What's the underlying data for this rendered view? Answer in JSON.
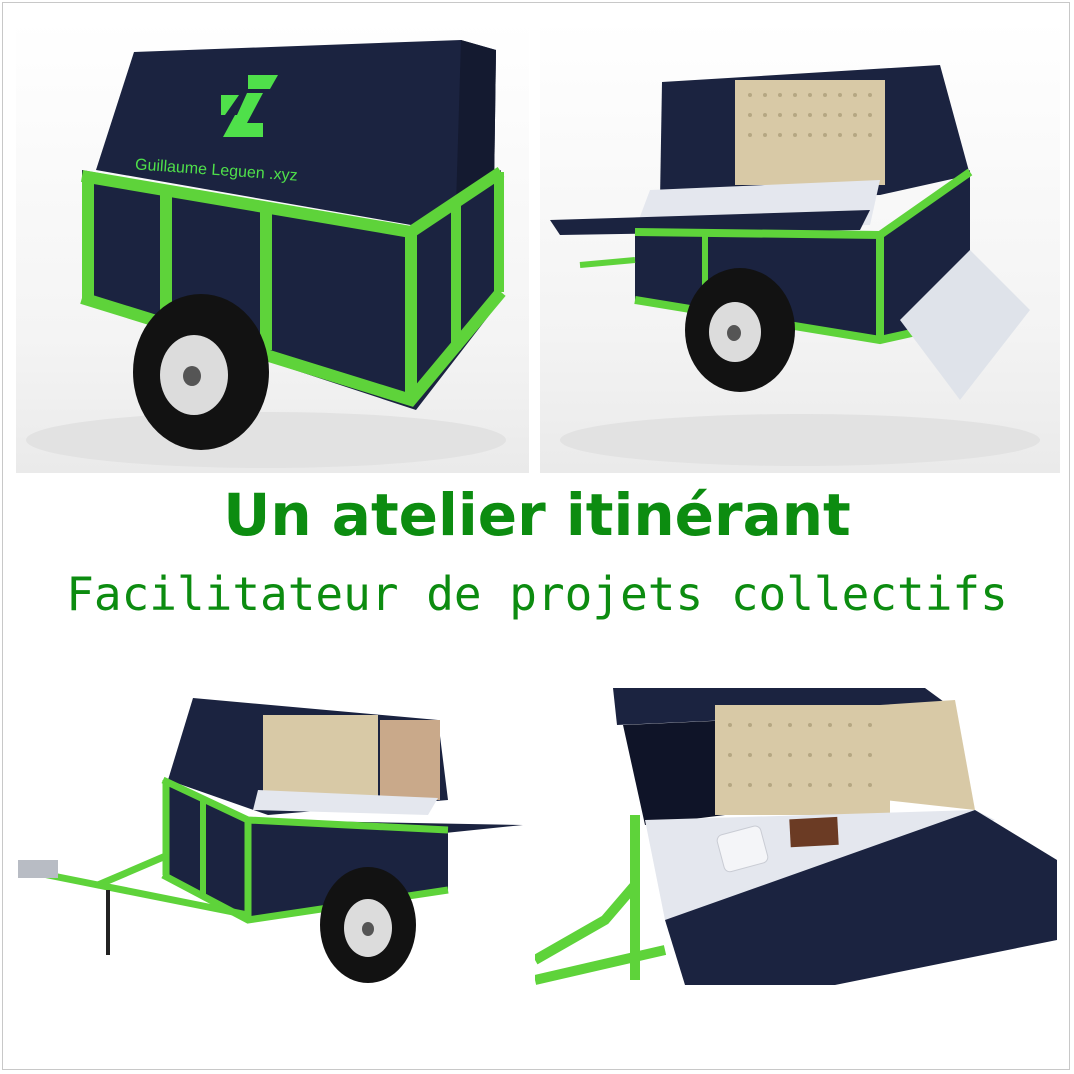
{
  "brand": {
    "label": "Guillaume Leguen .xyz",
    "logo_icon": "gl-logo-icon"
  },
  "heading": {
    "title": "Un atelier itinérant",
    "subtitle": "Facilitateur de projets collectifs"
  },
  "colors": {
    "frame_green": "#5ed33a",
    "panel_navy": "#1b2340",
    "title_green": "#0c8c10",
    "plywood": "#d8c9a6"
  },
  "renders": [
    {
      "view": "closed-trailer"
    },
    {
      "view": "open-trailer-side"
    },
    {
      "view": "open-trailer-rear-three-quarter"
    },
    {
      "view": "open-trailer-closeup"
    }
  ]
}
